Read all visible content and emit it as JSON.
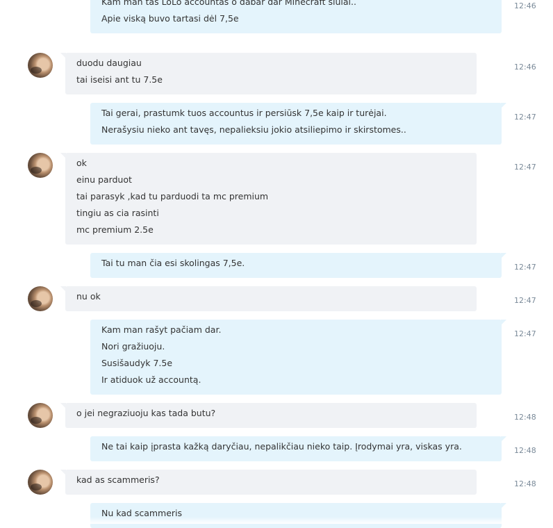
{
  "colors": {
    "outgoing_bubble": "#e4f4fc",
    "incoming_bubble": "#f0f2f5",
    "timestamp": "#7a8a99"
  },
  "messages": [
    {
      "direction": "outgoing",
      "time": "12:46",
      "lines": [
        "Kam man tas LoLo accountas o dabar dar Minecraft siūlai..",
        "Apie viską buvo tartasi dėl 7,5e"
      ]
    },
    {
      "direction": "incoming",
      "time": "12:46",
      "lines": [
        "duodu daugiau",
        "tai iseisi ant tu 7.5e"
      ]
    },
    {
      "direction": "outgoing",
      "time": "12:47",
      "lines": [
        "Tai gerai, prastumk tuos accountus ir persiūsk 7,5e kaip ir turėjai.",
        "Nerašysiu nieko ant tavęs, nepalieksiu jokio atsiliepimo ir skirstomes.."
      ]
    },
    {
      "direction": "incoming",
      "time": "12:47",
      "lines": [
        "ok",
        "einu parduot",
        "tai parasyk ,kad tu parduodi ta mc premium",
        "tingiu as cia rasinti",
        "mc premium 2.5e"
      ]
    },
    {
      "direction": "outgoing",
      "time": "12:47",
      "lines": [
        "Tai tu man čia esi skolingas 7,5e."
      ]
    },
    {
      "direction": "incoming",
      "time": "12:47",
      "lines": [
        "nu ok"
      ]
    },
    {
      "direction": "outgoing",
      "time": "12:47",
      "lines": [
        "Kam man rašyt pačiam dar.",
        "Nori gražiuoju.",
        "Susišaudyk 7.5e",
        "Ir atiduok už accountą."
      ]
    },
    {
      "direction": "incoming",
      "time": "12:48",
      "lines": [
        "o jei negraziuoju kas tada butu?"
      ]
    },
    {
      "direction": "outgoing",
      "time": "12:48",
      "lines": [
        "Ne tai kaip įprasta kažką daryčiau, nepalikčiau nieko taip. Įrodymai yra, viskas yra."
      ]
    },
    {
      "direction": "incoming",
      "time": "12:48",
      "lines": [
        " kad as scammeris?"
      ]
    },
    {
      "direction": "outgoing",
      "time": "",
      "lines": [
        "Nu kad scammeris"
      ]
    }
  ]
}
